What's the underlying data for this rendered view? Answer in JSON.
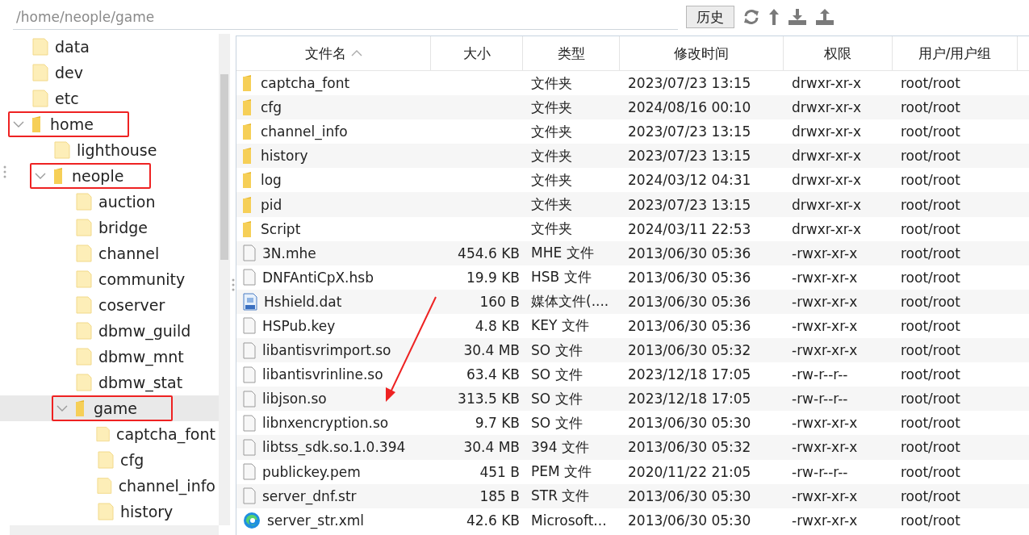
{
  "path_bar": {
    "value": "/home/neople/game",
    "history_button": "历史"
  },
  "tree": [
    {
      "label": "data",
      "expanded": false,
      "selected": false,
      "highlighted": false
    },
    {
      "label": "dev",
      "expanded": false,
      "selected": false,
      "highlighted": false
    },
    {
      "label": "etc",
      "expanded": false,
      "selected": false,
      "highlighted": false
    },
    {
      "label": "home",
      "expanded": true,
      "selected": false,
      "highlighted": true,
      "children": [
        {
          "label": "lighthouse",
          "expanded": false,
          "selected": false,
          "highlighted": false
        },
        {
          "label": "neople",
          "expanded": true,
          "selected": false,
          "highlighted": true,
          "children": [
            {
              "label": "auction",
              "expanded": false,
              "selected": false,
              "highlighted": false
            },
            {
              "label": "bridge",
              "expanded": false,
              "selected": false,
              "highlighted": false
            },
            {
              "label": "channel",
              "expanded": false,
              "selected": false,
              "highlighted": false
            },
            {
              "label": "community",
              "expanded": false,
              "selected": false,
              "highlighted": false
            },
            {
              "label": "coserver",
              "expanded": false,
              "selected": false,
              "highlighted": false
            },
            {
              "label": "dbmw_guild",
              "expanded": false,
              "selected": false,
              "highlighted": false
            },
            {
              "label": "dbmw_mnt",
              "expanded": false,
              "selected": false,
              "highlighted": false
            },
            {
              "label": "dbmw_stat",
              "expanded": false,
              "selected": false,
              "highlighted": false
            },
            {
              "label": "game",
              "expanded": true,
              "selected": true,
              "highlighted": true,
              "children": [
                {
                  "label": "captcha_font",
                  "expanded": false,
                  "selected": false,
                  "highlighted": false
                },
                {
                  "label": "cfg",
                  "expanded": false,
                  "selected": false,
                  "highlighted": false
                },
                {
                  "label": "channel_info",
                  "expanded": false,
                  "selected": false,
                  "highlighted": false
                },
                {
                  "label": "history",
                  "expanded": false,
                  "selected": false,
                  "highlighted": false
                }
              ]
            }
          ]
        }
      ]
    }
  ],
  "table": {
    "columns": [
      {
        "label": "文件名",
        "sorted": true
      },
      {
        "label": "大小",
        "sorted": false
      },
      {
        "label": "类型",
        "sorted": false
      },
      {
        "label": "修改时间",
        "sorted": false
      },
      {
        "label": "权限",
        "sorted": false
      },
      {
        "label": "用户/用户组",
        "sorted": false
      }
    ],
    "rows": [
      {
        "kind": "folder",
        "name": "captcha_font",
        "size": "",
        "type": "文件夹",
        "modified": "2023/07/23 13:15",
        "permissions": "drwxr-xr-x",
        "owner": "root/root"
      },
      {
        "kind": "folder",
        "name": "cfg",
        "size": "",
        "type": "文件夹",
        "modified": "2024/08/16 00:10",
        "permissions": "drwxr-xr-x",
        "owner": "root/root"
      },
      {
        "kind": "folder",
        "name": "channel_info",
        "size": "",
        "type": "文件夹",
        "modified": "2023/07/23 13:15",
        "permissions": "drwxr-xr-x",
        "owner": "root/root"
      },
      {
        "kind": "folder",
        "name": "history",
        "size": "",
        "type": "文件夹",
        "modified": "2023/07/23 13:15",
        "permissions": "drwxr-xr-x",
        "owner": "root/root"
      },
      {
        "kind": "folder",
        "name": "log",
        "size": "",
        "type": "文件夹",
        "modified": "2024/03/12 04:31",
        "permissions": "drwxr-xr-x",
        "owner": "root/root"
      },
      {
        "kind": "folder",
        "name": "pid",
        "size": "",
        "type": "文件夹",
        "modified": "2023/07/23 13:15",
        "permissions": "drwxr-xr-x",
        "owner": "root/root"
      },
      {
        "kind": "folder",
        "name": "Script",
        "size": "",
        "type": "文件夹",
        "modified": "2024/03/11 22:53",
        "permissions": "drwxr-xr-x",
        "owner": "root/root"
      },
      {
        "kind": "file",
        "name": "3N.mhe",
        "size": "454.6 KB",
        "type": "MHE 文件",
        "modified": "2013/06/30 05:36",
        "permissions": "-rwxr-xr-x",
        "owner": "root/root"
      },
      {
        "kind": "file",
        "name": "DNFAntiCpX.hsb",
        "size": "19.9 KB",
        "type": "HSB 文件",
        "modified": "2013/06/30 05:36",
        "permissions": "-rwxr-xr-x",
        "owner": "root/root"
      },
      {
        "kind": "media",
        "name": "Hshield.dat",
        "size": "160 B",
        "type": "媒体文件(....",
        "modified": "2013/06/30 05:36",
        "permissions": "-rwxr-xr-x",
        "owner": "root/root"
      },
      {
        "kind": "file",
        "name": "HSPub.key",
        "size": "4.8 KB",
        "type": "KEY 文件",
        "modified": "2013/06/30 05:36",
        "permissions": "-rwxr-xr-x",
        "owner": "root/root"
      },
      {
        "kind": "file",
        "name": "libantisvrimport.so",
        "size": "30.4 MB",
        "type": "SO 文件",
        "modified": "2013/06/30 05:32",
        "permissions": "-rwxr-xr-x",
        "owner": "root/root"
      },
      {
        "kind": "file",
        "name": "libantisvrinline.so",
        "size": "63.4 KB",
        "type": "SO 文件",
        "modified": "2023/12/18 17:05",
        "permissions": "-rw-r--r--",
        "owner": "root/root"
      },
      {
        "kind": "file",
        "name": "libjson.so",
        "size": "313.5 KB",
        "type": "SO 文件",
        "modified": "2023/12/18 17:05",
        "permissions": "-rw-r--r--",
        "owner": "root/root"
      },
      {
        "kind": "file",
        "name": "libnxencryption.so",
        "size": "9.7 KB",
        "type": "SO 文件",
        "modified": "2013/06/30 05:30",
        "permissions": "-rwxr-xr-x",
        "owner": "root/root"
      },
      {
        "kind": "file",
        "name": "libtss_sdk.so.1.0.394",
        "size": "30.4 MB",
        "type": "394 文件",
        "modified": "2013/06/30 05:32",
        "permissions": "-rwxr-xr-x",
        "owner": "root/root"
      },
      {
        "kind": "file",
        "name": "publickey.pem",
        "size": "451 B",
        "type": "PEM 文件",
        "modified": "2020/11/22 21:05",
        "permissions": "-rw-r--r--",
        "owner": "root/root"
      },
      {
        "kind": "file",
        "name": "server_dnf.str",
        "size": "185 B",
        "type": "STR 文件",
        "modified": "2013/06/30 05:30",
        "permissions": "-rwxr-xr-x",
        "owner": "root/root"
      },
      {
        "kind": "browser",
        "name": "server_str.xml",
        "size": "42.6 KB",
        "type": "Microsoft...",
        "modified": "2013/06/30 05:30",
        "permissions": "-rwxr-xr-x",
        "owner": "root/root"
      }
    ]
  }
}
